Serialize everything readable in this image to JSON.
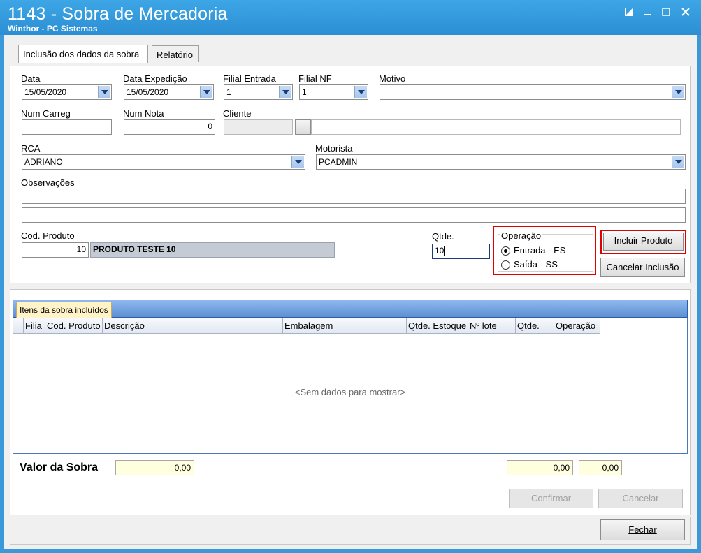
{
  "window": {
    "title": "1143 - Sobra de Mercadoria",
    "subtitle": "Winthor - PC Sistemas"
  },
  "tabs": [
    {
      "label": "Inclusão dos dados da sobra",
      "active": true
    },
    {
      "label": "Relatório",
      "active": false
    }
  ],
  "form": {
    "data": {
      "label": "Data",
      "value": "15/05/2020"
    },
    "data_expedicao": {
      "label": "Data Expedição",
      "value": "15/05/2020"
    },
    "filial_entrada": {
      "label": "Filial Entrada",
      "value": "1"
    },
    "filial_nf": {
      "label": "Filial NF",
      "value": "1"
    },
    "motivo": {
      "label": "Motivo",
      "value": ""
    },
    "num_carreg": {
      "label": "Num Carreg",
      "value": ""
    },
    "num_nota": {
      "label": "Num Nota",
      "value": "0"
    },
    "cliente": {
      "label": "Cliente",
      "code": "",
      "name": "",
      "lookup_label": "..."
    },
    "rca": {
      "label": "RCA",
      "value": "ADRIANO"
    },
    "motorista": {
      "label": "Motorista",
      "value": "PCADMIN"
    },
    "observacoes": {
      "label": "Observações",
      "line1": "",
      "line2": ""
    },
    "cod_produto": {
      "label": "Cod. Produto",
      "value": "10",
      "description": "PRODUTO TESTE 10"
    },
    "qtde": {
      "label": "Qtde.",
      "value": "10"
    },
    "operacao": {
      "label": "Operação",
      "options": [
        {
          "label": "Entrada - ES",
          "selected": true
        },
        {
          "label": "Saída - SS",
          "selected": false
        }
      ]
    },
    "buttons": {
      "incluir": "Incluir Produto",
      "cancelar_inclusao": "Cancelar Inclusão"
    }
  },
  "grid": {
    "tab_label": "Itens da sobra incluídos",
    "columns": [
      "Filia",
      "Cod. Produto",
      "Descrição",
      "Embalagem",
      "Qtde. Estoque",
      "Nº lote",
      "Qtde.",
      "Operação"
    ],
    "rows": [],
    "empty_text": "<Sem dados para mostrar>"
  },
  "summary": {
    "label": "Valor da Sobra",
    "valor": "0,00",
    "total1": "0,00",
    "total2": "0,00"
  },
  "footer": {
    "confirmar": "Confirmar",
    "cancelar": "Cancelar",
    "fechar": "Fechar"
  },
  "colors": {
    "titlebar": "#2c8fd3",
    "highlight": "#e00000",
    "grid_tab": "#fff3c7",
    "summary_field": "#ffffe0"
  }
}
